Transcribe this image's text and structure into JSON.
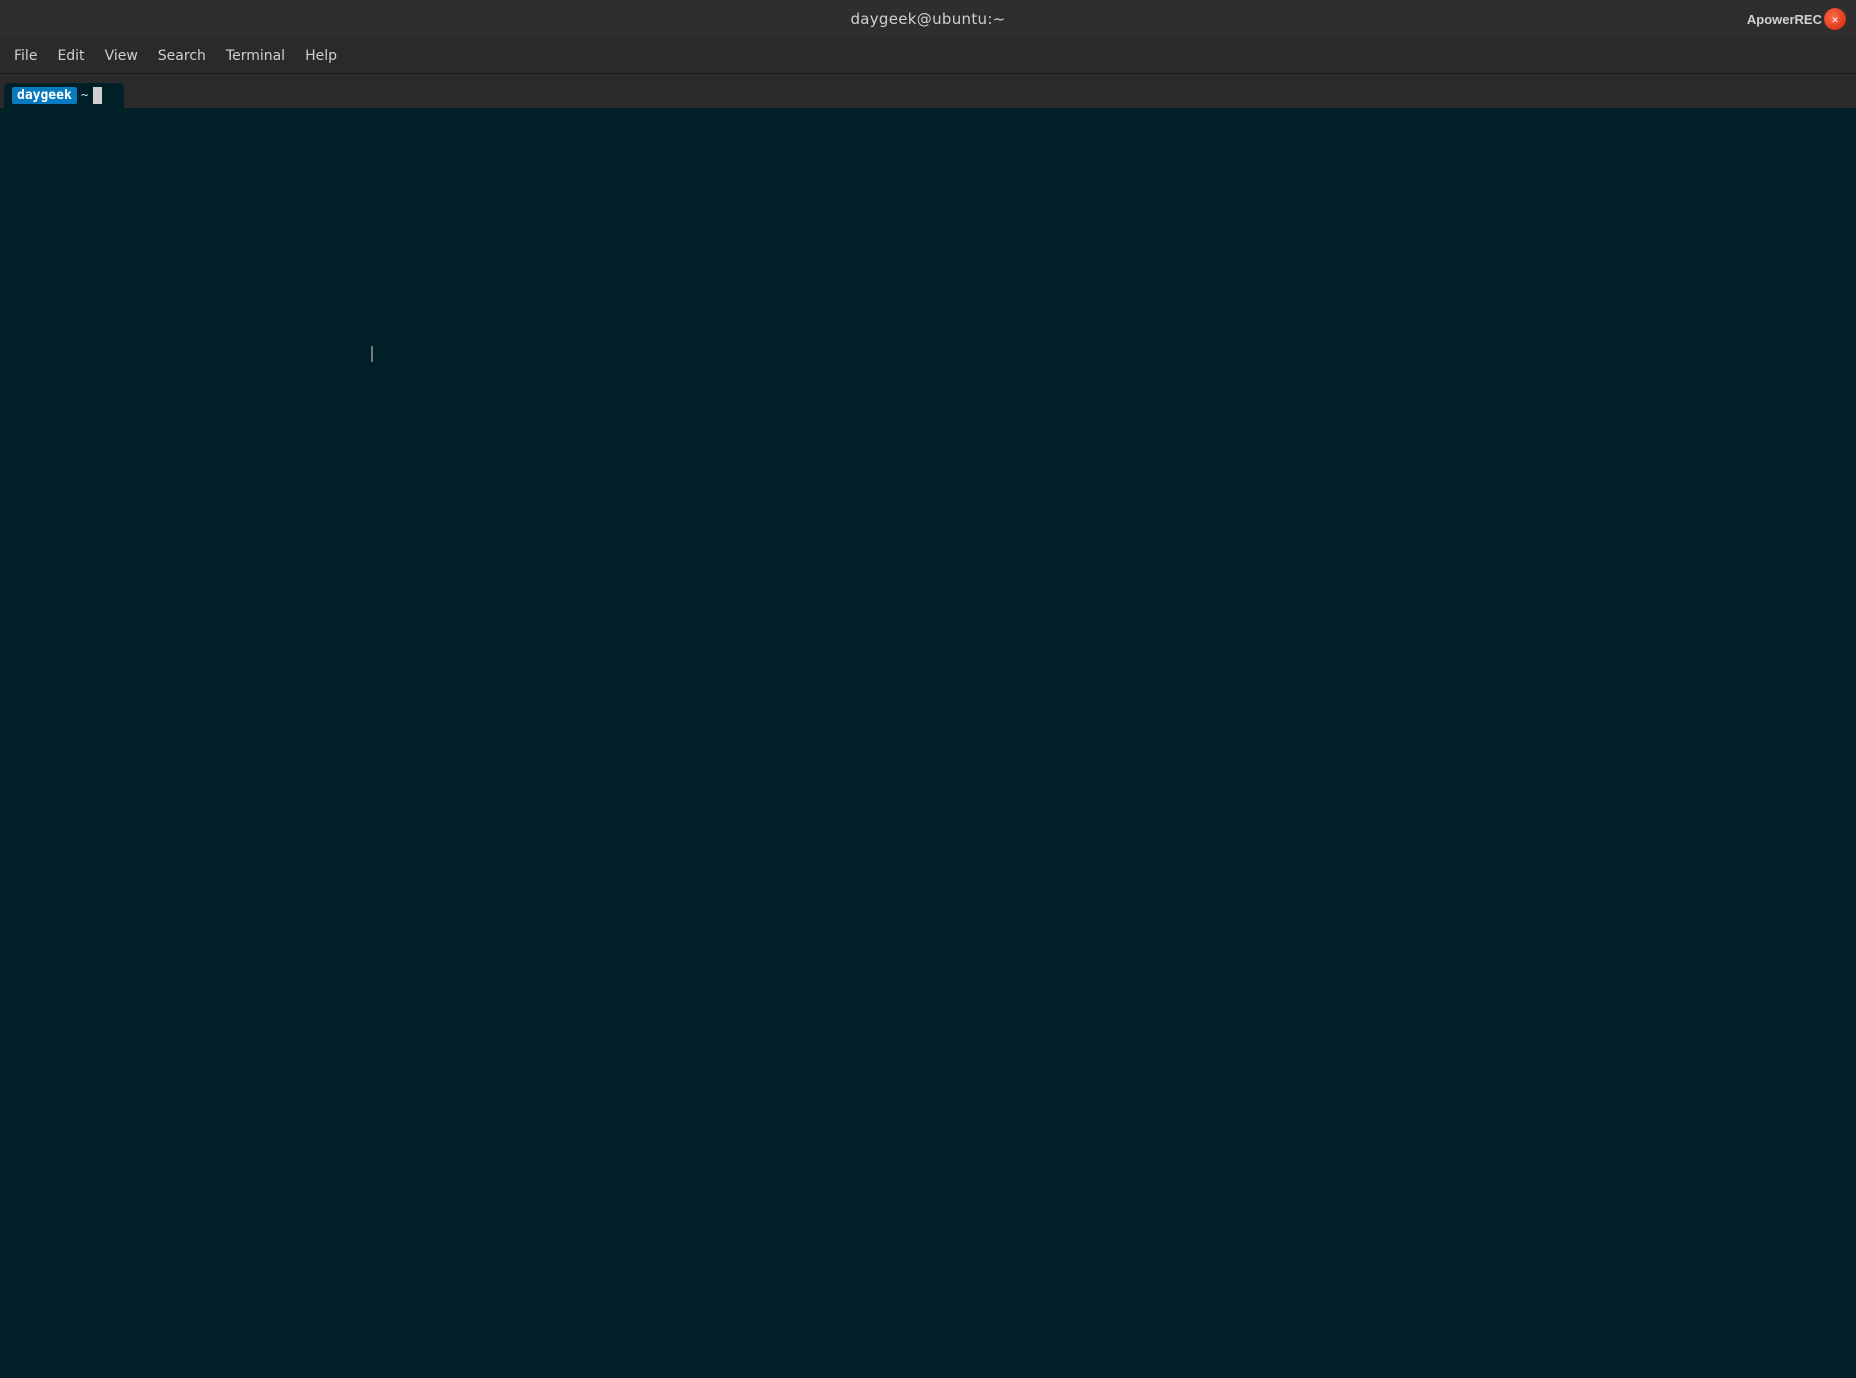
{
  "titlebar": {
    "title": "daygeek@ubuntu:~",
    "apowerrec_label": "ApowerREC"
  },
  "menubar": {
    "items": [
      {
        "label": "File",
        "id": "file"
      },
      {
        "label": "Edit",
        "id": "edit"
      },
      {
        "label": "View",
        "id": "view"
      },
      {
        "label": "Search",
        "id": "search"
      },
      {
        "label": "Terminal",
        "id": "terminal"
      },
      {
        "label": "Help",
        "id": "help"
      }
    ]
  },
  "tab": {
    "username": "daygeek",
    "tilde": "~"
  },
  "terminal": {
    "background_color": "#001f27"
  }
}
